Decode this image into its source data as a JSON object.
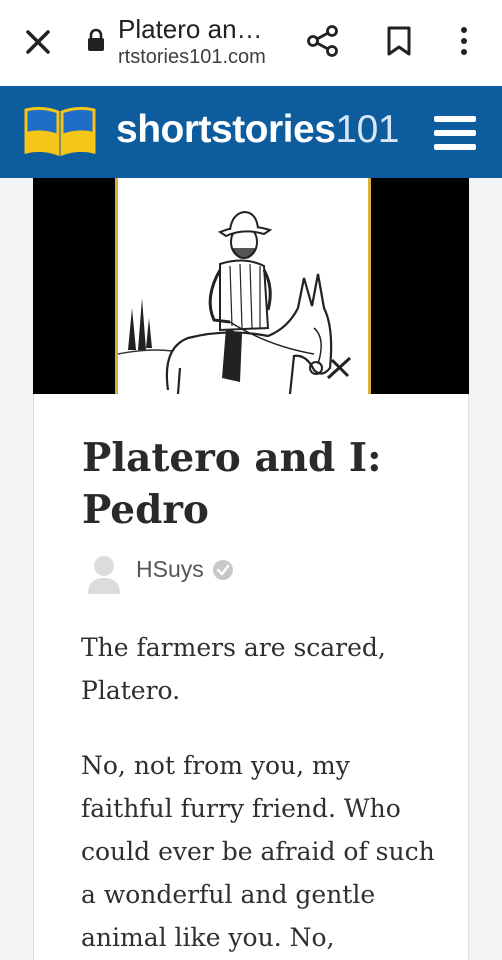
{
  "browser": {
    "tab_title": "Platero an…",
    "url": "rtstories101.com"
  },
  "site": {
    "brand_bold": "shortstories",
    "brand_light": "101"
  },
  "article": {
    "title": "Platero and I: Pedro",
    "author": "HSuys",
    "paragraphs": [
      "The farmers are scared, Platero.",
      "No, not from you, my faithful furry friend. Who could ever be afraid of such a wonderful and gentle animal like you. No,"
    ]
  },
  "colors": {
    "header_blue": "#0d5c9e",
    "logo_yellow": "#f5c518",
    "logo_blue": "#1e6ec8",
    "frame_gold": "#d7b03a"
  },
  "icons": [
    "close-icon",
    "lock-icon",
    "share-icon",
    "bookmark-icon",
    "more-vert-icon",
    "book-logo-icon",
    "menu-icon",
    "avatar-icon",
    "verified-icon"
  ]
}
